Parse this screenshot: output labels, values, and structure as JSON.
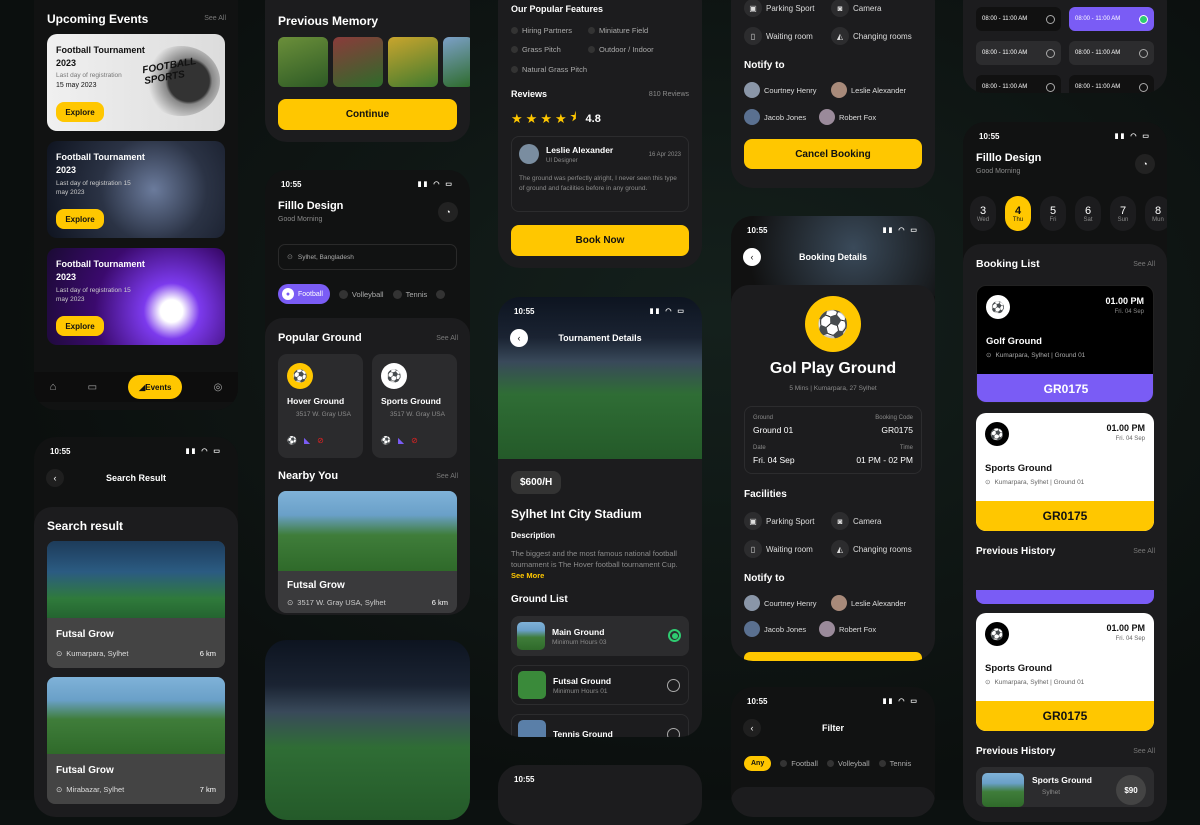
{
  "p1": {
    "title": "Upcoming Events",
    "see": "See All",
    "events": [
      {
        "name": "Football Tournament 2023",
        "sub": "Last day of registration",
        "date": "15 may 2023",
        "btn": "Explore",
        "art": "FOOTBALL SPORTS"
      },
      {
        "name": "Football Tournament 2023",
        "sub": "Last day of registration 15 may 2023",
        "btn": "Explore"
      },
      {
        "name": "Football Tournament 2023",
        "sub": "Last day of registration 15 may 2023",
        "btn": "Explore"
      }
    ],
    "nav_active": "Events"
  },
  "p2": {
    "time": "10:55",
    "title": "Search Result",
    "section": "Search result",
    "items": [
      {
        "name": "Futsal Grow",
        "loc": "Kumarpara, Sylhet",
        "dist": "6 km"
      },
      {
        "name": "Futsal Grow",
        "loc": "Mirabazar, Sylhet",
        "dist": "7 km"
      }
    ]
  },
  "p3": {
    "title": "Previous Memory",
    "btn": "Continue"
  },
  "p4": {
    "time": "10:55",
    "brand": "Filllo Design",
    "greet": "Good Morning",
    "location": "Sylhet, Bangladesh",
    "sports": [
      "Football",
      "Volleyball",
      "Tennis"
    ],
    "popular": "Popular Ground",
    "see": "See All",
    "grounds": [
      {
        "name": "Hover Ground",
        "addr": "3517 W. Gray USA"
      },
      {
        "name": "Sports Ground",
        "addr": "3517 W. Gray USA"
      }
    ],
    "nearby": "Nearby You",
    "near": {
      "name": "Futsal Grow",
      "addr": "3517 W. Gray USA, Sylhet",
      "dist": "6 km"
    }
  },
  "p5": {
    "features_title": "Our Popular Features",
    "features": [
      "Hiring Partners",
      "Miniature Field",
      "Grass Pitch",
      "Outdoor / Indoor",
      "Natural Grass Pitch"
    ],
    "reviews": "Reviews",
    "review_count": "810 Reviews",
    "rating": "4.8",
    "review": {
      "name": "Leslie Alexander",
      "role": "UI Designer",
      "date": "16 Apr 2023",
      "text": "The ground was perfectly alright, I never seen this type of ground and facilities before in any ground."
    },
    "btn": "Book Now"
  },
  "p6": {
    "time": "10:55",
    "title": "Tournament Details",
    "price": "$600/H",
    "stadium": "Sylhet Int City Stadium",
    "desc_title": "Description",
    "desc": "The biggest and the most famous national football tournament is The Hover football tournament Cup.",
    "more": "See More",
    "list_title": "Ground List",
    "list": [
      {
        "name": "Main Ground",
        "hours": "Minimum Hours 03"
      },
      {
        "name": "Futsal Ground",
        "hours": "Minimum Hours 01"
      },
      {
        "name": "Tennis Ground",
        "hours": ""
      }
    ],
    "time2": "10:55"
  },
  "p7": {
    "facilities": [
      [
        "Parking Sport",
        "Camera"
      ],
      [
        "Waiting room",
        "Changing rooms"
      ]
    ],
    "notify": "Notify to",
    "people": [
      "Courtney Henry",
      "Leslie Alexander",
      "Jacob Jones",
      "Robert Fox"
    ],
    "btn": "Cancel Booking"
  },
  "p8": {
    "time": "10:55",
    "title": "Booking Details",
    "ground": "Gol Play Ground",
    "meta": "5 Mins | Kumarpara, 27 Sylhet",
    "k1": "Ground",
    "v1": "Ground 01",
    "k2": "Booking Code",
    "v2": "GR0175",
    "k3": "Date",
    "v3": "Fri. 04 Sep",
    "k4": "Time",
    "v4": "01 PM - 02 PM",
    "fac_title": "Facilities",
    "facilities": [
      [
        "Parking Sport",
        "Camera"
      ],
      [
        "Waiting room",
        "Changing rooms"
      ]
    ],
    "notify": "Notify to",
    "people": [
      "Courtney Henry",
      "Leslie Alexander",
      "Jacob Jones",
      "Robert Fox"
    ]
  },
  "p9": {
    "time": "10:55",
    "title": "Filter",
    "chips": [
      "Any",
      "Football",
      "Volleyball",
      "Tennis"
    ]
  },
  "p10": {
    "slots": [
      "08:00 - 11:00 AM",
      "08:00 - 11:00 AM",
      "08:00 - 11:00 AM",
      "08:00 - 11:00 AM",
      "08:00 - 11:00 AM",
      "08:00 - 11:00 AM"
    ]
  },
  "p11": {
    "time": "10:55",
    "brand": "Filllo Design",
    "greet": "Good Morning",
    "days": [
      {
        "n": "3",
        "d": "Wed"
      },
      {
        "n": "4",
        "d": "Thu"
      },
      {
        "n": "5",
        "d": "Fri"
      },
      {
        "n": "6",
        "d": "Sat"
      },
      {
        "n": "7",
        "d": "Sun"
      },
      {
        "n": "8",
        "d": "Mun"
      }
    ],
    "list": "Booking List",
    "see": "See All",
    "t1": {
      "time": "01.00 PM",
      "date": "Fri. 04 Sep",
      "name": "Golf Ground",
      "loc": "Kumarpara, Sylhet | Ground 01",
      "code": "GR0175"
    },
    "t2": {
      "time": "01.00 PM",
      "date": "Fri. 04 Sep",
      "name": "Sports Ground",
      "loc": "Kumarpara, Sylhet | Ground 01",
      "code": "GR0175"
    },
    "hist": "Previous History",
    "t3": {
      "time": "01.00 PM",
      "date": "Fri. 04 Sep",
      "name": "Sports Ground",
      "loc": "Kumarpara, Sylhet | Ground 01",
      "code": "GR0175"
    },
    "hist2": "Previous History",
    "h_item": {
      "name": "Sports Ground",
      "loc": "Sylhet",
      "price": "$90"
    }
  }
}
